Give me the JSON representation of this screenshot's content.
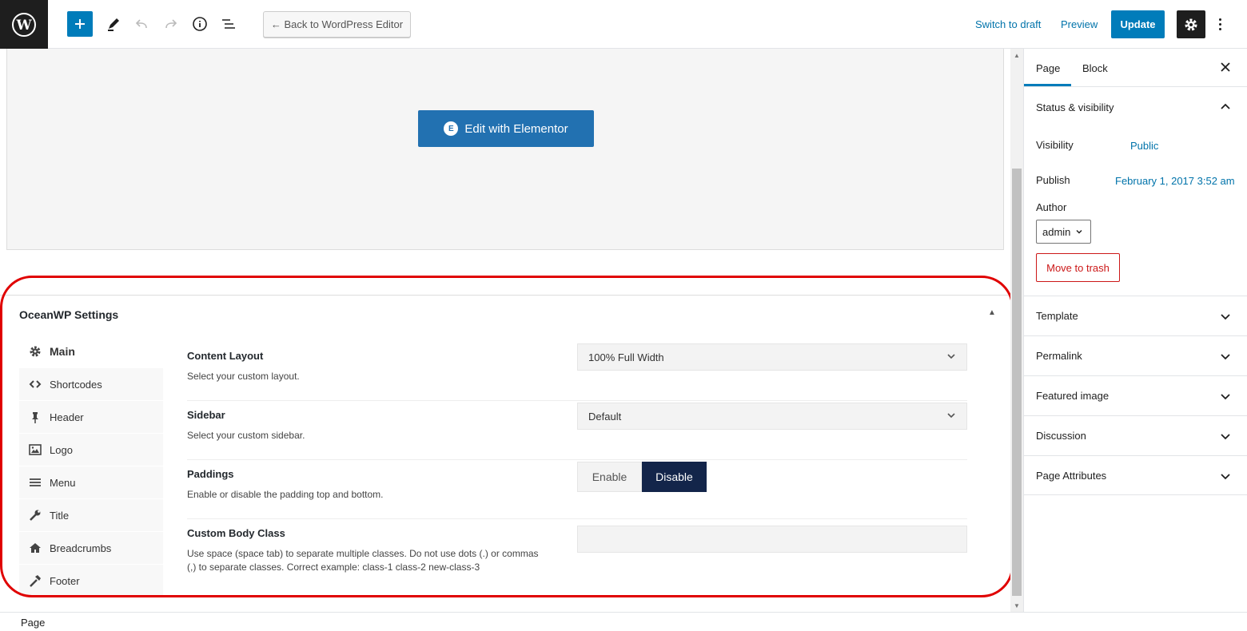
{
  "toolbar": {
    "back_label": "← Back to WordPress Editor",
    "switch_to_draft": "Switch to draft",
    "preview": "Preview",
    "update": "Update"
  },
  "editor": {
    "elementor_button": "Edit with Elementor",
    "elementor_badge": "E"
  },
  "oceanwp": {
    "title": "OceanWP Settings",
    "nav": [
      {
        "label": "Main",
        "icon": "gear-icon",
        "active": true
      },
      {
        "label": "Shortcodes",
        "icon": "code-icon"
      },
      {
        "label": "Header",
        "icon": "pin-icon"
      },
      {
        "label": "Logo",
        "icon": "image-icon"
      },
      {
        "label": "Menu",
        "icon": "menu-icon"
      },
      {
        "label": "Title",
        "icon": "wrench-icon"
      },
      {
        "label": "Breadcrumbs",
        "icon": "home-icon"
      },
      {
        "label": "Footer",
        "icon": "hammer-icon"
      }
    ],
    "fields": {
      "content_layout": {
        "label": "Content Layout",
        "desc": "Select your custom layout.",
        "value": "100% Full Width"
      },
      "sidebar": {
        "label": "Sidebar",
        "desc": "Select your custom sidebar.",
        "value": "Default"
      },
      "paddings": {
        "label": "Paddings",
        "desc": "Enable or disable the padding top and bottom.",
        "enable": "Enable",
        "disable": "Disable",
        "selected": "Disable"
      },
      "body_class": {
        "label": "Custom Body Class",
        "desc": "Use space (space tab) to separate multiple classes. Do not use dots (.) or commas (,) to separate classes. Correct example: class-1 class-2 new-class-3",
        "value": ""
      }
    }
  },
  "sidebar": {
    "tabs": [
      "Page",
      "Block"
    ],
    "active_tab": "Page",
    "status": {
      "title": "Status & visibility",
      "visibility_label": "Visibility",
      "visibility_value": "Public",
      "publish_label": "Publish",
      "publish_value": "February 1, 2017 3:52 am",
      "author_label": "Author",
      "author_value": "admin",
      "trash": "Move to trash"
    },
    "sections": [
      "Template",
      "Permalink",
      "Featured image",
      "Discussion",
      "Page Attributes"
    ]
  },
  "footer": {
    "breadcrumb": "Page"
  },
  "colors": {
    "accent": "#007cba",
    "highlight": "#e00000",
    "toggle_active": "#13254a",
    "danger": "#cc1818"
  }
}
